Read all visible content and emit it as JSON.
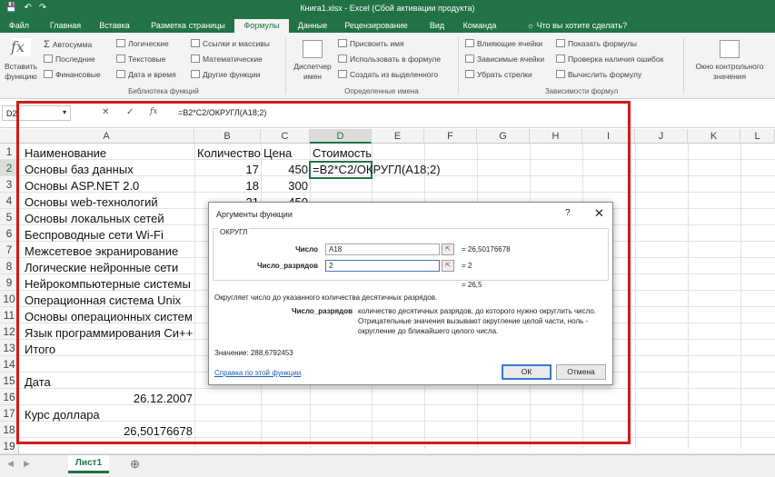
{
  "window": {
    "title": "Книга1.xlsx - Excel (Сбой активации продукта)",
    "qa_save": "💾",
    "qa_undo": "↶",
    "qa_redo": "↷"
  },
  "tabs": [
    "Файл",
    "Главная",
    "Вставка",
    "Разметка страницы",
    "Формулы",
    "Данные",
    "Рецензирование",
    "Вид",
    "Команда",
    "Что вы хотите сделать?"
  ],
  "ribbon": {
    "insert_function": "Вставить функцию",
    "autosum": "Автосумма",
    "recent": "Последние",
    "financial": "Финансовые",
    "logical": "Логические",
    "text": "Текстовые",
    "datetime": "Дата и время",
    "lookup": "Ссылки и массивы",
    "math": "Математические",
    "other": "Другие функции",
    "group_library": "Библиотека функций",
    "name_manager": "Диспетчер имен",
    "define_name": "Присвоить имя",
    "use_in_formula": "Использовать в формуле",
    "create_from_sel": "Создать из выделенного",
    "group_names": "Определенные имена",
    "trace_precedents": "Влияющие ячейки",
    "trace_dependents": "Зависимые ячейки",
    "remove_arrows": "Убрать стрелки",
    "show_formulas": "Показать формулы",
    "error_check": "Проверка наличия ошибок",
    "evaluate": "Вычислить формулу",
    "group_audit": "Зависимости формул",
    "watch_window": "Окно контрольного значения"
  },
  "formula_bar": {
    "name_box": "D2",
    "formula": "=B2*C2/ОКРУГЛ(A18;2)",
    "cancel": "✕",
    "enter": "✓",
    "fx": "fx"
  },
  "columns": [
    "A",
    "B",
    "C",
    "D",
    "E",
    "F",
    "G",
    "H",
    "I",
    "J",
    "K",
    "L"
  ],
  "rows": [
    "1",
    "2",
    "3",
    "4",
    "5",
    "6",
    "7",
    "8",
    "9",
    "10",
    "11",
    "12",
    "13",
    "14",
    "15",
    "16",
    "17",
    "18",
    "19"
  ],
  "cells": {
    "a1": "Наименование",
    "b1": "Количество",
    "c1": "Цена",
    "d1": "Стоимость",
    "a2": "Основы баз данных",
    "b2": "17",
    "c2": "450",
    "d2": "=B2*C2/ОКРУГЛ(A18;2)",
    "a3": "Основы ASP.NET 2.0",
    "b3": "18",
    "c3": "300",
    "a4": "Основы web-технологий",
    "b4": "21",
    "c4": "450",
    "a5": "Основы локальных сетей",
    "a6": "Беспроводные сети Wi-Fi",
    "a7": "Межсетевое экранирование",
    "a8": "Логические нейронные сети",
    "a9": "Нейрокомпьютерные системы",
    "a10": "Операционная система Unix",
    "a11": "Основы операционных систем",
    "a12": "Язык программирования Си++",
    "a13": "Итого",
    "a15": "Дата",
    "a16": "26.12.2007",
    "a17": "Курс доллара",
    "a18": "26,50176678"
  },
  "sheet": {
    "tab": "Лист1",
    "add": "⊕"
  },
  "dialog": {
    "title": "Аргументы функции",
    "help": "?",
    "close": "✕",
    "function_name": "ОКРУГЛ",
    "arg1_label": "Число",
    "arg1_value": "A18",
    "arg1_result": "= 26,50176678",
    "arg2_label": "Число_разрядов",
    "arg2_value": "2",
    "arg2_result": "= 2",
    "total_result": "= 26,5",
    "description": "Округляет число до указанного количества десятичных разрядов.",
    "param_name": "Число_разрядов",
    "param_desc": "количество десятичных разрядов, до которого нужно округлить число. Отрицательные значения вызывают округление целой части, ноль - округление до ближайшего целого числа.",
    "value_text": "Значение:  288,6792453",
    "help_link": "Справка по этой функции",
    "ok": "ОК",
    "cancel": "Отмена"
  }
}
